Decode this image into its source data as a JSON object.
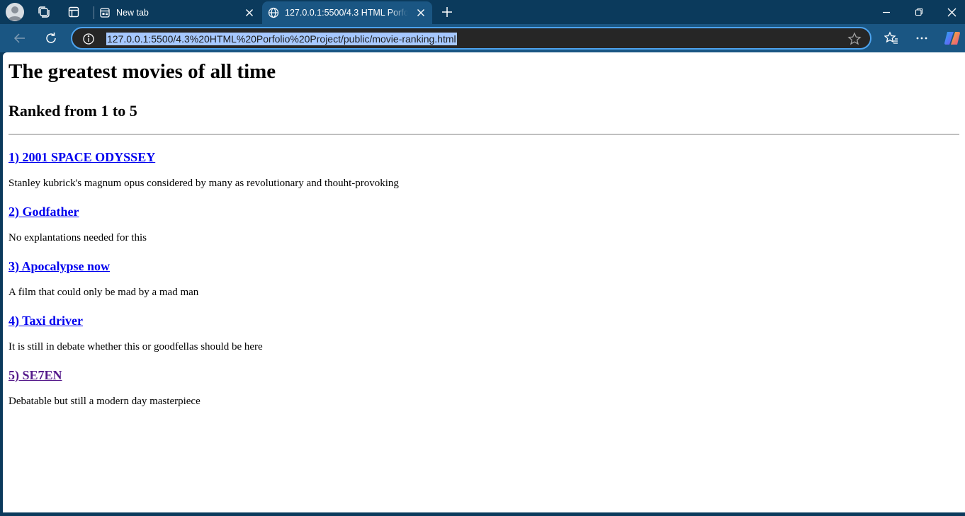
{
  "browser": {
    "tabs": [
      {
        "title": "New tab",
        "active": false
      },
      {
        "title": "127.0.0.1:5500/4.3 HTML Porfolio Project/public/movie-ranking.html",
        "active": true
      }
    ],
    "address_bar": {
      "url": "127.0.0.1:5500/4.3%20HTML%20Porfolio%20Project/public/movie-ranking.html"
    },
    "icons": {
      "avatar": "profile-avatar-icon",
      "workspaces": "workspaces-icon",
      "tab_actions": "tab-actions-icon",
      "new_tab": "plus-icon",
      "back": "back-arrow-icon",
      "reload": "reload-icon",
      "site_info": "info-icon",
      "favorite": "star-icon",
      "favorites": "favorites-icon",
      "more": "ellipsis-icon",
      "copilot": "copilot-icon"
    },
    "colors": {
      "frame": "#0b3a5c",
      "toolbar": "#1a5683",
      "omnibox": "#262626",
      "omnibox_border": "#4da3ee",
      "url_highlight": "#a6c8ff"
    }
  },
  "page": {
    "title": "The greatest movies of all time",
    "subtitle": "Ranked from 1 to 5",
    "movies": [
      {
        "heading": "1) 2001 SPACE ODYSSEY",
        "description": "Stanley kubrick's magnum opus considered by many as revolutionary and thouht-provoking",
        "visited": false
      },
      {
        "heading": "2) Godfather",
        "description": "No explantations needed for this",
        "visited": false
      },
      {
        "heading": "3) Apocalypse now",
        "description": "A film that could only be mad by a mad man",
        "visited": false
      },
      {
        "heading": "4) Taxi driver",
        "description": "It is still in debate whether this or goodfellas should be here",
        "visited": false
      },
      {
        "heading": "5) SE7EN",
        "description": "Debatable but still a modern day masterpiece",
        "visited": true
      }
    ],
    "colors": {
      "link": "#0000ee",
      "visited_link": "#551a8b"
    }
  }
}
